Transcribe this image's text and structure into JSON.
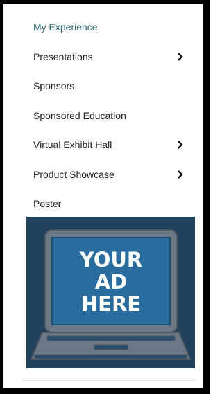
{
  "menu": {
    "items": [
      {
        "label": "My Experience",
        "active": true,
        "has_submenu": false
      },
      {
        "label": "Presentations",
        "active": false,
        "has_submenu": true
      },
      {
        "label": "Sponsors",
        "active": false,
        "has_submenu": false
      },
      {
        "label": "Sponsored Education",
        "active": false,
        "has_submenu": false
      },
      {
        "label": "Virtual Exhibit Hall",
        "active": false,
        "has_submenu": true
      },
      {
        "label": "Product Showcase",
        "active": false,
        "has_submenu": true
      },
      {
        "label": "Poster",
        "active": false,
        "has_submenu": false
      }
    ]
  },
  "ad": {
    "lines": [
      "YOUR",
      "AD",
      "HERE"
    ]
  },
  "colors": {
    "active_text": "#2e6b6b",
    "ad_background": "#21415e",
    "screen": "#2a6c9e",
    "laptop_frame": "#6b7885"
  },
  "icons": {
    "submenu": "chevron-right-icon"
  }
}
